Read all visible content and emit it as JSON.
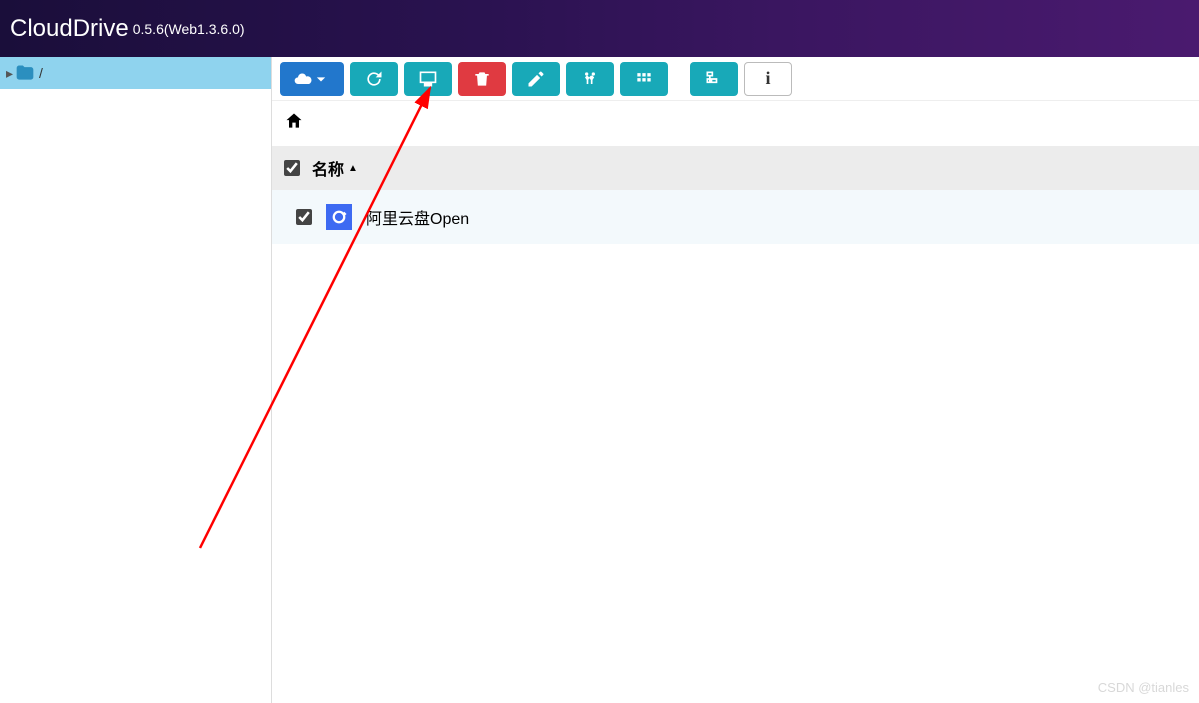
{
  "header": {
    "title": "CloudDrive",
    "version": "0.5.6(Web1.3.6.0)"
  },
  "sidebar": {
    "path_separator": "/"
  },
  "toolbar": {
    "buttons": [
      {
        "name": "add-cloud",
        "style": "blue wide"
      },
      {
        "name": "refresh",
        "style": "teal"
      },
      {
        "name": "mount-local",
        "style": "teal"
      },
      {
        "name": "delete",
        "style": "red"
      },
      {
        "name": "rename",
        "style": "teal"
      },
      {
        "name": "move",
        "style": "teal"
      },
      {
        "name": "view-grid",
        "style": "teal"
      },
      {
        "name": "gap"
      },
      {
        "name": "tree",
        "style": "teal"
      },
      {
        "name": "info",
        "style": "white"
      }
    ]
  },
  "list": {
    "column_name": "名称",
    "select_all_checked": true,
    "items": [
      {
        "checked": true,
        "name": "阿里云盘Open",
        "icon": "aliyun-drive"
      }
    ]
  },
  "watermark": "CSDN @tianles"
}
